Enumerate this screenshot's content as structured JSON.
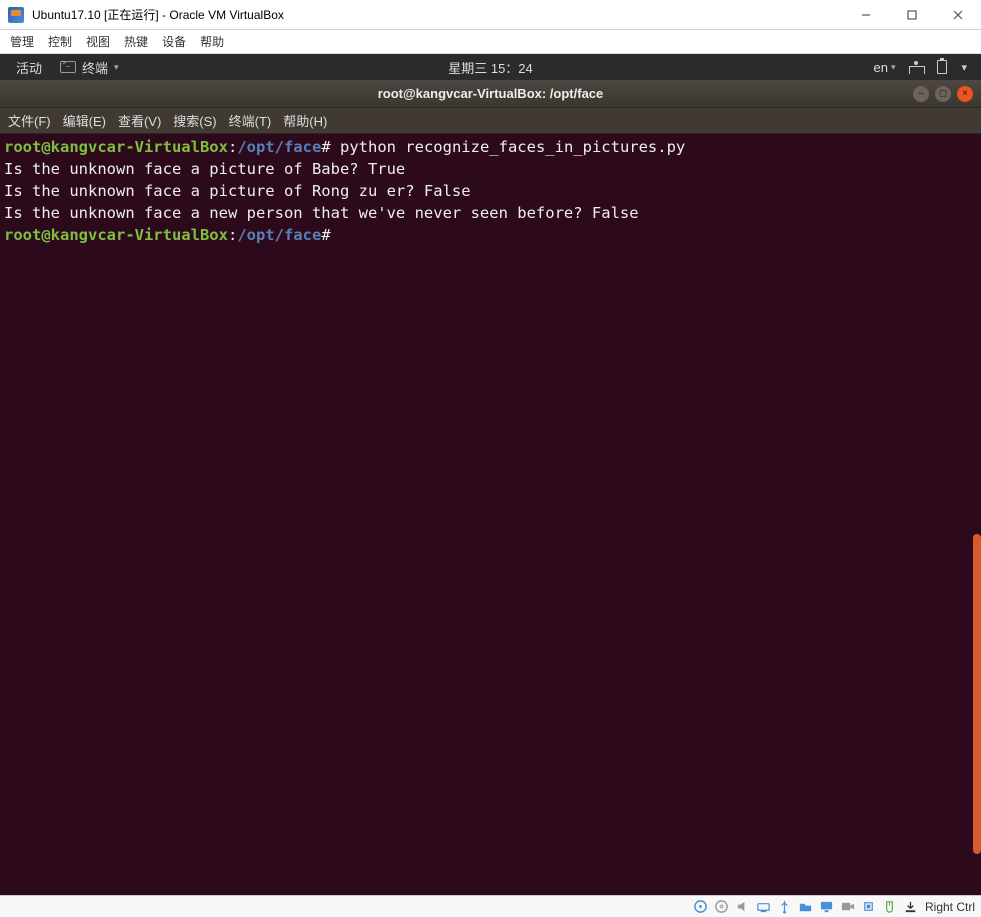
{
  "vbox": {
    "title": "Ubuntu17.10 [正在运行] - Oracle VM VirtualBox",
    "menu": {
      "manage": "管理",
      "control": "控制",
      "view": "视图",
      "hotkeys": "热键",
      "devices": "设备",
      "help": "帮助"
    },
    "winbtn": {
      "min": "—",
      "max": "☐",
      "close": "✕"
    },
    "status": {
      "hostkey": "Right Ctrl"
    }
  },
  "gnome": {
    "activities": "活动",
    "appmenu": "终端",
    "dropdown": "▾",
    "datetime": "星期三 15：24",
    "lang": "en",
    "langdrop": "▾",
    "sysdrop": "▾"
  },
  "term": {
    "title": "root@kangvcar-VirtualBox: /opt/face",
    "winbtn": {
      "min": "–",
      "max": "◻",
      "close": "×"
    },
    "menu": {
      "file": "文件(F)",
      "edit": "编辑(E)",
      "view": "查看(V)",
      "search": "搜索(S)",
      "terminal": "终端(T)",
      "help": "帮助(H)"
    },
    "prompt": {
      "user": "root@kangvcar-VirtualBox",
      "colon": ":",
      "path": "/opt/face",
      "hash": "#"
    },
    "cmd1": " python recognize_faces_in_pictures.py",
    "out1": "Is the unknown face a picture of Babe? True",
    "out2": "Is the unknown face a picture of Rong zu er? False",
    "out3": "Is the unknown face a new person that we've never seen before? False",
    "cmd2": " "
  }
}
